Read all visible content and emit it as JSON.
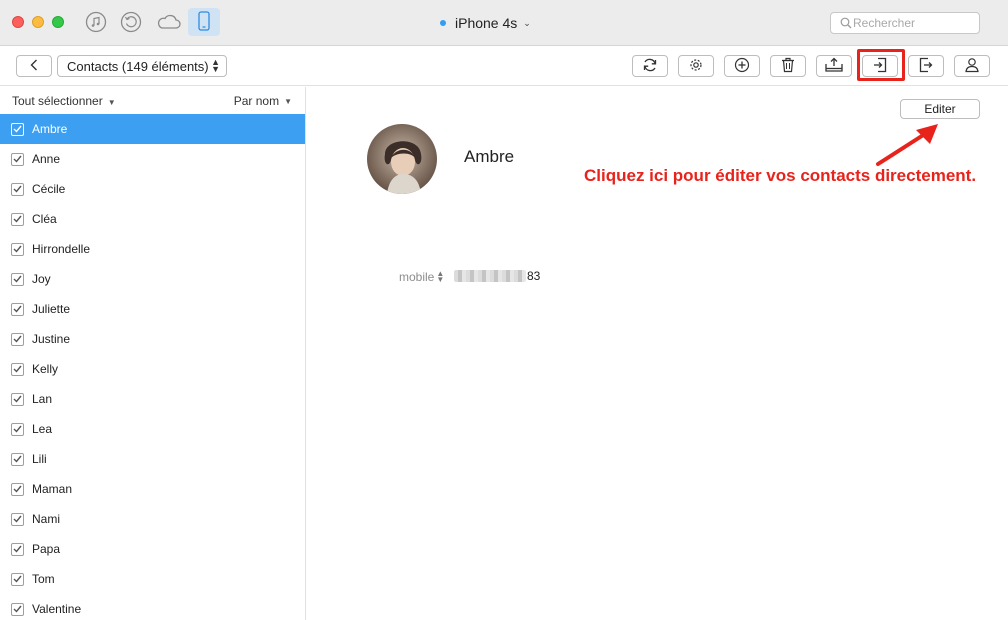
{
  "titlebar": {
    "device_name": "iPhone 4s",
    "search_placeholder": "Rechercher",
    "icons": [
      "music-icon",
      "history-icon",
      "cloud-icon",
      "iphone-icon"
    ]
  },
  "toolbar": {
    "category_label": "Contacts (149 éléments)",
    "tools": [
      "refresh-icon",
      "settings-icon",
      "add-icon",
      "trash-icon",
      "export-to-computer-icon",
      "import-icon",
      "export-to-device-icon",
      "contact-card-icon"
    ]
  },
  "sidebar": {
    "select_all_label": "Tout sélectionner",
    "sort_label": "Par nom",
    "items": [
      {
        "label": "Ambre",
        "selected": true
      },
      {
        "label": "Anne",
        "selected": false
      },
      {
        "label": "Cécile",
        "selected": false
      },
      {
        "label": "Cléa",
        "selected": false
      },
      {
        "label": "Hirrondelle",
        "selected": false
      },
      {
        "label": "Joy",
        "selected": false
      },
      {
        "label": "Juliette",
        "selected": false
      },
      {
        "label": "Justine",
        "selected": false
      },
      {
        "label": "Kelly",
        "selected": false
      },
      {
        "label": "Lan",
        "selected": false
      },
      {
        "label": "Lea",
        "selected": false
      },
      {
        "label": "Lili",
        "selected": false
      },
      {
        "label": "Maman",
        "selected": false
      },
      {
        "label": "Nami",
        "selected": false
      },
      {
        "label": "Papa",
        "selected": false
      },
      {
        "label": "Tom",
        "selected": false
      },
      {
        "label": "Valentine",
        "selected": false
      }
    ]
  },
  "detail": {
    "edit_label": "Editer",
    "contact_name": "Ambre",
    "phone_type": "mobile",
    "phone_suffix": "83"
  },
  "annotation": {
    "text": "Cliquez ici pour éditer vos contacts directement.",
    "color": "#e8231c"
  },
  "colors": {
    "selection": "#3d9ff1",
    "device_button": "#cfe3f5",
    "highlight": "#e8231c"
  }
}
